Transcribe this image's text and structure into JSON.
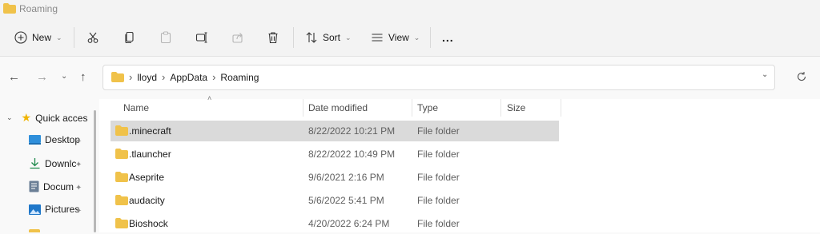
{
  "window": {
    "title": "Roaming"
  },
  "toolbar": {
    "new_label": "New",
    "sort_label": "Sort",
    "view_label": "View",
    "more_label": "..."
  },
  "address": {
    "crumbs": [
      "lloyd",
      "AppData",
      "Roaming"
    ]
  },
  "sidebar": {
    "items": [
      {
        "label": "Quick acces",
        "icon": "star-icon"
      },
      {
        "label": "Desktop",
        "icon": "desktop-icon"
      },
      {
        "label": "Downlc",
        "icon": "download-icon"
      },
      {
        "label": "Docum",
        "icon": "document-icon"
      },
      {
        "label": "Pictures",
        "icon": "pictures-icon"
      }
    ]
  },
  "list": {
    "columns": [
      "Name",
      "Date modified",
      "Type",
      "Size"
    ],
    "rows": [
      {
        "name": ".minecraft",
        "date": "8/22/2022 10:21 PM",
        "type": "File folder",
        "size": ""
      },
      {
        "name": ".tlauncher",
        "date": "8/22/2022 10:49 PM",
        "type": "File folder",
        "size": ""
      },
      {
        "name": "Aseprite",
        "date": "9/6/2021 2:16 PM",
        "type": "File folder",
        "size": ""
      },
      {
        "name": "audacity",
        "date": "5/6/2022 5:41 PM",
        "type": "File folder",
        "size": ""
      },
      {
        "name": "Bioshock",
        "date": "4/20/2022 6:24 PM",
        "type": "File folder",
        "size": ""
      }
    ]
  },
  "colors": {
    "folder": "#f0c24a",
    "selection": "#dadada",
    "accent": "#0067c0"
  }
}
